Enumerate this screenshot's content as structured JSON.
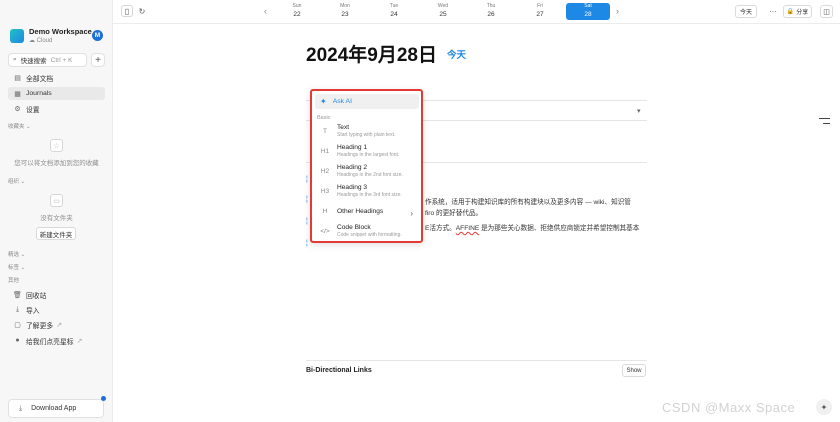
{
  "workspace": {
    "name": "Demo Workspace",
    "sync": "Cloud",
    "avatar_letter": "M"
  },
  "search": {
    "label": "快速搜索",
    "shortcut": "Ctrl + K"
  },
  "sidebar": {
    "items": [
      {
        "label": "全部文档",
        "icon": "file-icon"
      },
      {
        "label": "Journals",
        "icon": "calendar-icon"
      },
      {
        "label": "设置",
        "icon": "gear-icon"
      }
    ],
    "favorites_label": "收藏夹",
    "favorites_empty": "您可以将文档添加到您的收藏",
    "organize_label": "组织",
    "folders_empty": "没有文件夹",
    "new_folder": "新建文件夹",
    "tags_label": "精选",
    "tags2_label": "标签",
    "other_label": "其他",
    "bottom_items": [
      {
        "label": "回收站",
        "icon": "trash-icon"
      },
      {
        "label": "导入",
        "icon": "import-icon"
      },
      {
        "label": "了解更多",
        "icon": "info-icon"
      },
      {
        "label": "给我们点亮星标",
        "icon": "github-icon"
      }
    ],
    "download": "Download App"
  },
  "topbar": {
    "days": [
      {
        "name": "Sun",
        "date": "22"
      },
      {
        "name": "Mon",
        "date": "23"
      },
      {
        "name": "Tue",
        "date": "24"
      },
      {
        "name": "Wed",
        "date": "25"
      },
      {
        "name": "Thu",
        "date": "26"
      },
      {
        "name": "Fri",
        "date": "27"
      },
      {
        "name": "Sat",
        "date": "28"
      }
    ],
    "today": "今天",
    "more": "···",
    "share": "分享"
  },
  "editor": {
    "title": "2024年9月28日",
    "today_tag": "今天",
    "line1": "作系统，适用于构建知识库的所有构建块以及更多内容 — wiki、知识管",
    "line2": "firo 的更好替代品。",
    "line3_a": "E活方式。",
    "line3_err": "AFFINE",
    "line3_b": " 是为那些关心数据、拒绝供应商锁定并希望控制其基本",
    "bidi": "Bi-Directional Links",
    "show": "Show"
  },
  "menu": {
    "ask_ai": "Ask AI",
    "group": "Basic",
    "items": [
      {
        "icon": "T",
        "label": "Text",
        "desc": "Start typing with plain text."
      },
      {
        "icon": "H1",
        "label": "Heading 1",
        "desc": "Headings in the largest font."
      },
      {
        "icon": "H2",
        "label": "Heading 2",
        "desc": "Headings in the 2nd font size."
      },
      {
        "icon": "H3",
        "label": "Heading 3",
        "desc": "Headings in the 3rd font size."
      },
      {
        "icon": "H",
        "label": "Other Headings",
        "desc": ""
      },
      {
        "icon": "</>",
        "label": "Code Block",
        "desc": "Code snippet with formatting."
      }
    ]
  },
  "watermark": "CSDN @Maxx Space",
  "colors": {
    "accent": "#1e88e5",
    "highlight": "#e53935"
  }
}
